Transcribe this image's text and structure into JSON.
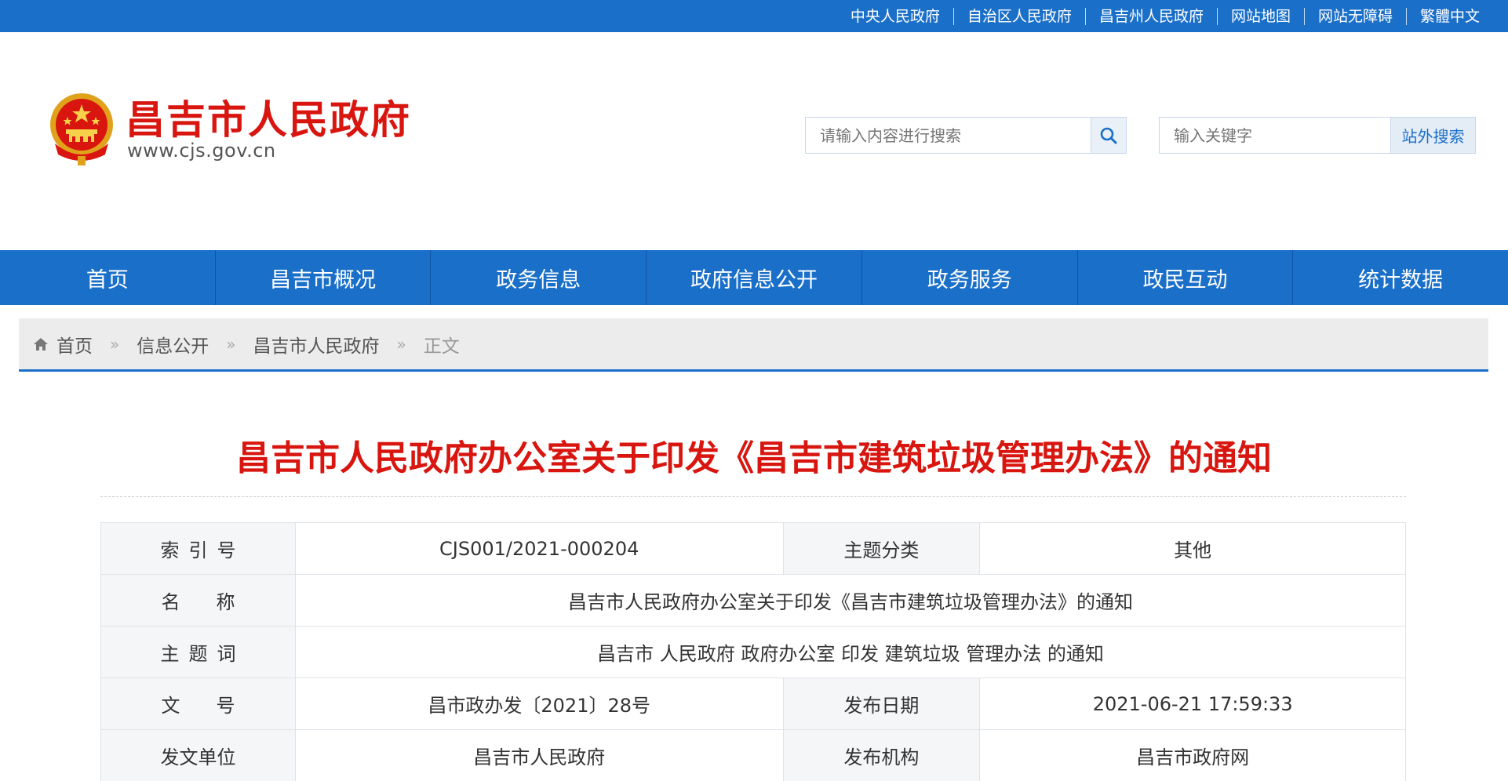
{
  "top_links": [
    "中央人民政府",
    "自治区人民政府",
    "昌吉州人民政府",
    "网站地图",
    "网站无障碍",
    "繁體中文"
  ],
  "header": {
    "site_title": "昌吉市人民政府",
    "site_url": "www.cjs.gov.cn",
    "search_placeholder": "请输入内容进行搜索",
    "external_search_placeholder": "输入关键字",
    "external_search_button": "站外搜索"
  },
  "nav": [
    "首页",
    "昌吉市概况",
    "政务信息",
    "政府信息公开",
    "政务服务",
    "政民互动",
    "统计数据"
  ],
  "breadcrumb": {
    "home": "首页",
    "separator": "»",
    "level1": "信息公开",
    "level2": "昌吉市人民政府",
    "current": "正文"
  },
  "document": {
    "title": "昌吉市人民政府办公室关于印发《昌吉市建筑垃圾管理办法》的通知",
    "index_label": "索引号",
    "index_value": "CJS001/2021-000204",
    "topic_label": "主题分类",
    "topic_value": "其他",
    "name_label": "名称",
    "name_value": "昌吉市人民政府办公室关于印发《昌吉市建筑垃圾管理办法》的通知",
    "keywords_label": "主题词",
    "keywords_value": "昌吉市 人民政府 政府办公室 印发 建筑垃圾 管理办法 的通知",
    "docno_label": "文号",
    "docno_value": "昌市政办发〔2021〕28号",
    "date_label": "发布日期",
    "date_value": "2021-06-21 17:59:33",
    "issuer_label": "发文单位",
    "issuer_value": "昌吉市人民政府",
    "publisher_label": "发布机构",
    "publisher_value": "昌吉市政府网"
  },
  "colors": {
    "brand_blue": "#1a6fc9",
    "title_red": "#d8160f"
  },
  "icons": [
    "national-emblem-icon",
    "search-icon",
    "home-icon"
  ]
}
